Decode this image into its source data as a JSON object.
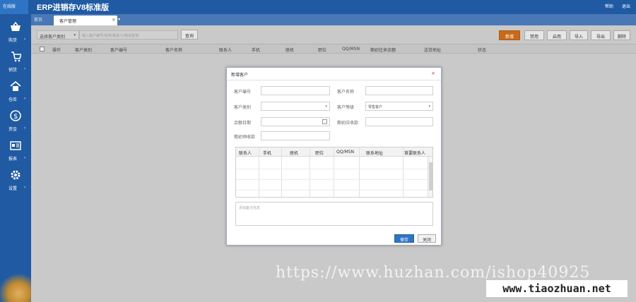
{
  "app": {
    "badge": "在线版",
    "title": "ERP进销存V8标准版",
    "top_links": [
      "帮助",
      "退出"
    ]
  },
  "sidebar": {
    "items": [
      {
        "label": "购货",
        "icon": "basket-icon"
      },
      {
        "label": "销货",
        "icon": "cart-icon"
      },
      {
        "label": "仓库",
        "icon": "warehouse-icon"
      },
      {
        "label": "资金",
        "icon": "money-icon"
      },
      {
        "label": "报表",
        "icon": "report-icon"
      },
      {
        "label": "设置",
        "icon": "gear-icon"
      }
    ],
    "arrow": "›"
  },
  "tabs": {
    "home": "首页",
    "active": "客户管理",
    "close": "×",
    "dropdown": "▾"
  },
  "toolbar": {
    "category_select": "选择客户类别",
    "search_placeholder": "输入客户编号/名称/联系人/电话查询",
    "query_button": "查询",
    "buttons": [
      "新增",
      "禁用",
      "启用",
      "导入",
      "导出",
      "删除"
    ]
  },
  "table": {
    "headers": [
      "操作",
      "客户类别",
      "客户编号",
      "客户名称",
      "联系人",
      "手机",
      "座机",
      "职位",
      "QQ/MSN",
      "期初往来余额",
      "送货地址",
      "状态"
    ]
  },
  "dialog": {
    "title": "新增客户",
    "close": "×",
    "fields": {
      "customer_no_label": "客户编号",
      "customer_name_label": "客户名称",
      "customer_category_label": "客户类别",
      "customer_level_label": "客户等级",
      "customer_level_value": "零售客户",
      "balance_date_label": "余额日期",
      "opening_receivable_label": "期初应收款",
      "opening_prepaid_label": "期初预收款"
    },
    "grid_headers": [
      "联系人",
      "手机",
      "座机",
      "职位",
      "QQ/MSN",
      "联系地址",
      "首要联系人"
    ],
    "remark_placeholder": "添加备注信息",
    "save_button": "保存",
    "close_button": "关闭"
  },
  "watermark": {
    "url": "https://www.huzhan.com/ishop40925",
    "site": "www.tiaozhuan.net"
  },
  "colors": {
    "header_blue": "#1f5aa3",
    "tab_blue": "#4a78b6",
    "primary_orange": "#c96a1a",
    "save_blue": "#2e74c4"
  }
}
